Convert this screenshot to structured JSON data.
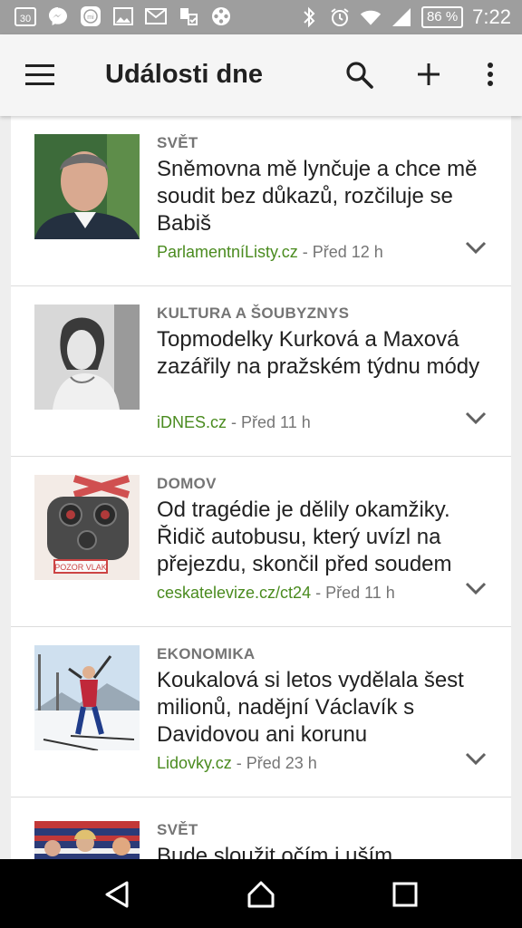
{
  "statusbar": {
    "left_icons": [
      "calendar-icon",
      "messenger-icon",
      "mi-icon",
      "image-icon",
      "gmail-icon",
      "transfer-icon",
      "film-reel-icon"
    ],
    "calendar_day": "30",
    "battery": "86 %",
    "time": "7:22"
  },
  "appbar": {
    "title": "Události dne"
  },
  "articles": [
    {
      "category": "SVĚT",
      "headline": "Sněmovna mě lynčuje a chce mě soudit bez důkazů, rozčiluje se Babiš",
      "source": "ParlamentníListy.cz",
      "time": "Před 12 h",
      "thumb": "portrait-man"
    },
    {
      "category": "KULTURA A ŠOUBYZNYS",
      "headline": "Topmodelky Kurková a Maxová zazářily na pražském týdnu módy",
      "source": "iDNES.cz",
      "time": "Před 11 h",
      "thumb": "bw-woman"
    },
    {
      "category": "DOMOV",
      "headline": "Od tragédie je dělily okamžiky. Řidič autobusu, který uvízl na přejezdu, skončil před soudem",
      "source": "ceskatelevize.cz/ct24",
      "time": "Před 11 h",
      "thumb": "crossing-signal",
      "sign_text": "POZOR VLAK"
    },
    {
      "category": "EKONOMIKA",
      "headline": "Koukalová si letos vydělala šest milionů, nadějní Václavík s Davidovou ani korunu",
      "source": "Lidovky.cz",
      "time": "Před 23 h",
      "thumb": "biathlete"
    },
    {
      "category": "SVĚT",
      "headline": "Bude sloužit očím i uším",
      "source": "",
      "time": "",
      "thumb": "flags-crowd"
    }
  ],
  "meta_separator": " - "
}
